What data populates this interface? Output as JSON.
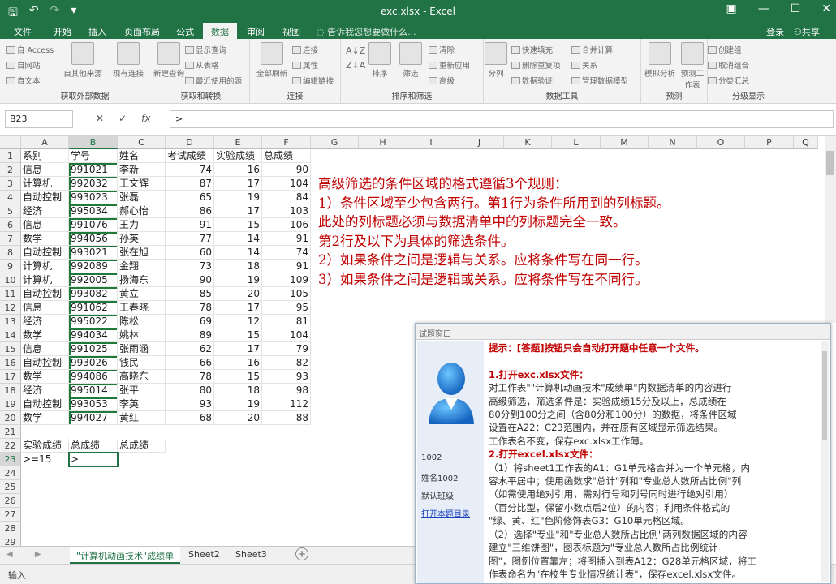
{
  "title_bar": {
    "window_title": "exc.xlsx - Excel",
    "quick_access": {
      "save": "🖫",
      "undo": "↶",
      "redo": "↷",
      "customize": "▾"
    },
    "window_controls": {
      "ribbon_options": "▣",
      "minimize": "—",
      "maximize": "☐",
      "close": "✕"
    }
  },
  "ribbon_tabs": [
    "文件",
    "开始",
    "插入",
    "页面布局",
    "公式",
    "数据",
    "审阅",
    "视图"
  ],
  "active_tab": "数据",
  "tell_me": "告诉我您想要做什么...",
  "login": "登录",
  "share": "共享",
  "ribbon_groups": {
    "external": {
      "label": "获取外部数据",
      "items": [
        "自 Access",
        "自网站",
        "自文本"
      ],
      "big": [
        "自其他来源",
        "现有连接"
      ]
    },
    "transform": {
      "label": "获取和转换",
      "big": "新建查询",
      "items": [
        "显示查询",
        "从表格",
        "最近使用的源"
      ]
    },
    "connections": {
      "label": "连接",
      "big": "全部刷新",
      "items": [
        "连接",
        "属性",
        "编辑链接"
      ]
    },
    "sort_filter": {
      "label": "排序和筛选",
      "big": [
        "排序",
        "筛选"
      ],
      "items": [
        "清除",
        "重新应用",
        "高级"
      ]
    },
    "data_tools": {
      "label": "数据工具",
      "big": "分列",
      "items": [
        "快速填充",
        "删除重复项",
        "数据验证",
        "合并计算",
        "关系",
        "管理数据模型"
      ]
    },
    "forecast": {
      "label": "预测",
      "big": [
        "模拟分析",
        "预测工作表"
      ]
    },
    "outline": {
      "label": "分级显示",
      "items": [
        "创建组",
        "取消组合",
        "分类汇总"
      ]
    }
  },
  "name_box": "B23",
  "formula_buttons": {
    "cancel": "✕",
    "enter": "✓",
    "fx": "fx"
  },
  "formula_value": ">",
  "columns": [
    "A",
    "B",
    "C",
    "D",
    "E",
    "F",
    "G",
    "H",
    "I",
    "J",
    "K",
    "L",
    "M",
    "N",
    "O",
    "P",
    "Q"
  ],
  "header_row": [
    "系别",
    "学号",
    "姓名",
    "考试成绩",
    "实验成绩",
    "总成绩"
  ],
  "rows": [
    [
      "信息",
      "991021",
      "李新",
      "74",
      "16",
      "90"
    ],
    [
      "计算机",
      "992032",
      "王文辉",
      "87",
      "17",
      "104"
    ],
    [
      "自动控制",
      "993023",
      "张磊",
      "65",
      "19",
      "84"
    ],
    [
      "经济",
      "995034",
      "郝心怡",
      "86",
      "17",
      "103"
    ],
    [
      "信息",
      "991076",
      "王力",
      "91",
      "15",
      "106"
    ],
    [
      "数学",
      "994056",
      "孙英",
      "77",
      "14",
      "91"
    ],
    [
      "自动控制",
      "993021",
      "张在旭",
      "60",
      "14",
      "74"
    ],
    [
      "计算机",
      "992089",
      "金翔",
      "73",
      "18",
      "91"
    ],
    [
      "计算机",
      "992005",
      "扬海东",
      "90",
      "19",
      "109"
    ],
    [
      "自动控制",
      "993082",
      "黄立",
      "85",
      "20",
      "105"
    ],
    [
      "信息",
      "991062",
      "王春晓",
      "78",
      "17",
      "95"
    ],
    [
      "经济",
      "995022",
      "陈松",
      "69",
      "12",
      "81"
    ],
    [
      "数学",
      "994034",
      "姚林",
      "89",
      "15",
      "104"
    ],
    [
      "信息",
      "991025",
      "张雨涵",
      "62",
      "17",
      "79"
    ],
    [
      "自动控制",
      "993026",
      "钱民",
      "66",
      "16",
      "82"
    ],
    [
      "数学",
      "994086",
      "高晓东",
      "78",
      "15",
      "93"
    ],
    [
      "经济",
      "995014",
      "张平",
      "80",
      "18",
      "98"
    ],
    [
      "自动控制",
      "993053",
      "李英",
      "93",
      "19",
      "112"
    ],
    [
      "数学",
      "994027",
      "黄红",
      "68",
      "20",
      "88"
    ]
  ],
  "criteria_header": [
    "实验成绩",
    "总成绩",
    "总成绩"
  ],
  "criteria_row": [
    ">=15",
    ">"
  ],
  "row_numbers": [
    "1",
    "2",
    "3",
    "4",
    "5",
    "6",
    "7",
    "8",
    "9",
    "10",
    "11",
    "12",
    "13",
    "14",
    "15",
    "16",
    "17",
    "18",
    "19",
    "20",
    "21",
    "22",
    "23",
    "24",
    "25",
    "26",
    "27",
    "28",
    "29"
  ],
  "annotation": [
    "高级筛选的条件区域的格式遵循3个规则：",
    "1）条件区域至少包含两行。第1行为条件所用到的列标题。",
    "此处的列标题必须与数据清单中的列标题完全一致。",
    "第2行及以下为具体的筛选条件。",
    "2）如果条件之间是逻辑与关系。应将条件写在同一行。",
    "3）如果条件之间是逻辑或关系。应将条件写在不同行。"
  ],
  "sheet_tabs": [
    "\"计算机动画技术\"成绩单",
    "Sheet2",
    "Sheet3"
  ],
  "sheet_nav": "◀ ▶",
  "sheet_add": "+",
  "status_text": "输入",
  "tip_window": {
    "title": "试题窗口",
    "user_id": "1002",
    "user_name": "姓名1002",
    "class": "默认班级",
    "open_dir_link": "打开本题目录",
    "lines": [
      "提示：[答题]按钮只会自动打开题中任意一个文件。",
      "",
      "1.打开exc.xlsx文件：",
      "对工作表\"\"计算机动画技术\"成绩单\"内数据清单的内容进行",
      "高级筛选，筛选条件是：实验成绩15分及以上，总成绩在",
      "80分到100分之间（含80分和100分）的数据，将条件区域",
      "设置在A22：C23范围内，并在原有区域显示筛选结果。",
      "工作表名不变，保存exc.xlsx工作薄。",
      "2.打开excel.xlsx文件：",
      "（1）将sheet1工作表的A1：G1单元格合并为一个单元格，内",
      "容水平居中；使用函数求\"总计\"列和\"专业总人数所占比例\"列",
      "（如需使用绝对引用，需对行号和列号同时进行绝对引用）",
      "（百分比型，保留小数点后2位）的内容；利用条件格式的",
      "\"绿、黄、红\"色阶修饰表G3：G10单元格区域。",
      "（2）选择\"专业\"和\"专业总人数所占比例\"两列数据区域的内容",
      "建立\"三维饼图\"，图表标题为\"专业总人数所占比例统计",
      "图\"，图例位置靠左；将图插入到表A12：G28单元格区域，将工",
      "作表命名为\"在校生专业情况统计表\"，保存excel.xlsx文件。"
    ]
  }
}
